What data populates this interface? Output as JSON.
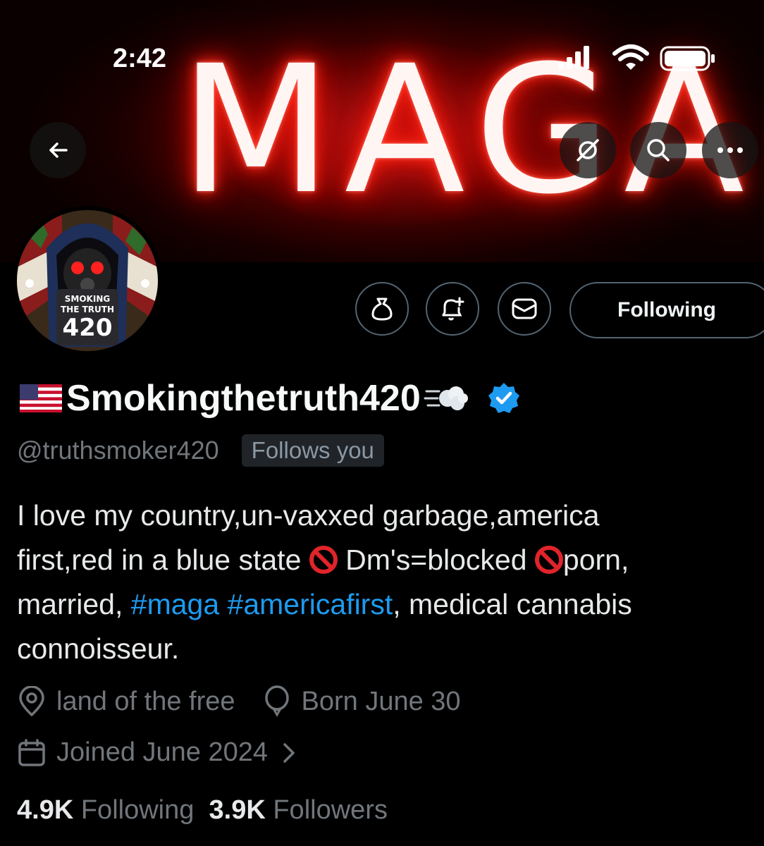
{
  "status_bar": {
    "time": "2:42"
  },
  "banner": {
    "text": "MAGA"
  },
  "avatar": {
    "line1": "SMOKING",
    "line2": "THE TRUTH",
    "number": "420"
  },
  "header_buttons": {
    "following_label": "Following"
  },
  "profile": {
    "display_name": "Smokingthetruth420",
    "handle": "@truthsmoker420",
    "follows_you": "Follows you",
    "bio": {
      "line1": "I love my country,un-vaxxed garbage,america",
      "line2a": "first,red in a blue state ",
      "line2b": " Dm's=blocked ",
      "line2c": "porn,",
      "line3a": "married, ",
      "tag1": "#maga",
      "tag2": "#americafirst",
      "line3b": ", medical cannabis",
      "line4": "connoisseur."
    },
    "location": "land of the free",
    "birthday": "Born June 30",
    "joined": "Joined June 2024",
    "following_count": "4.9K",
    "following_label": "Following",
    "followers_count": "3.9K",
    "followers_label": "Followers"
  },
  "colors": {
    "accent": "#1d9bf0",
    "ban": "#e0242a",
    "muted": "#71767b"
  }
}
